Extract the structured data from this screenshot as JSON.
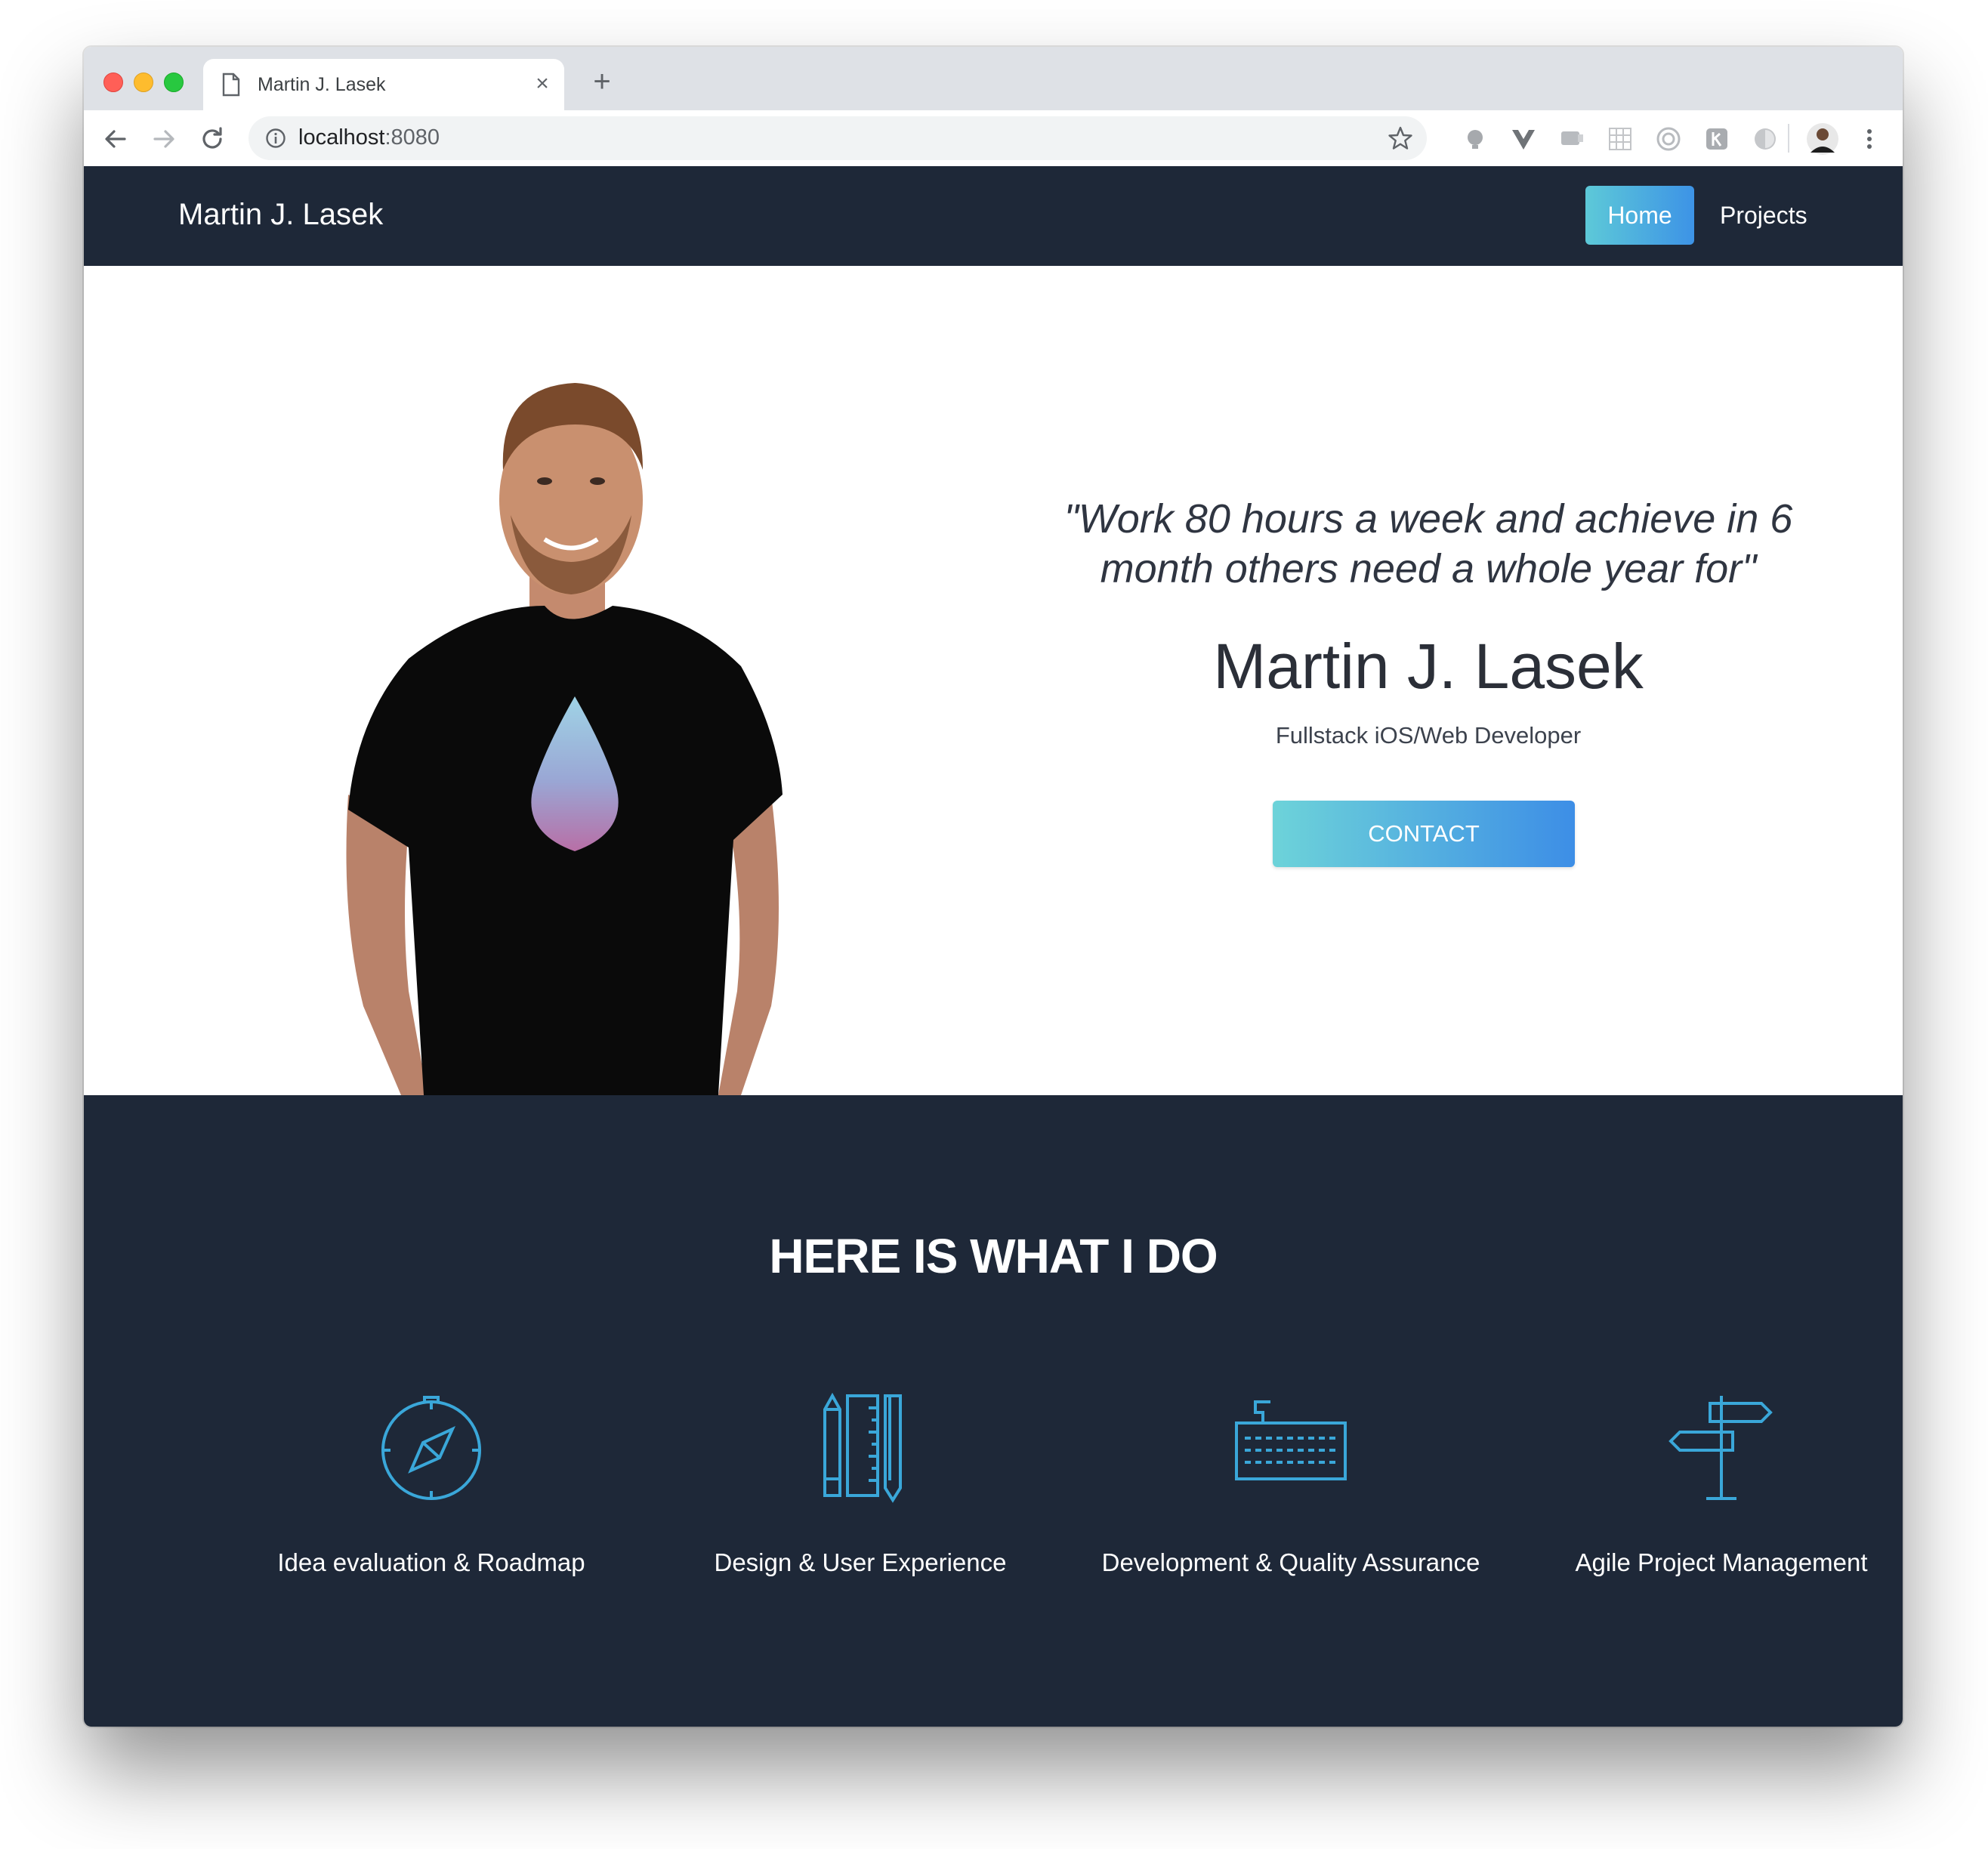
{
  "browser": {
    "tab_title": "Martin J. Lasek",
    "url_host": "localhost",
    "url_port": ":8080"
  },
  "nav": {
    "brand": "Martin J. Lasek",
    "items": [
      {
        "label": "Home",
        "active": true
      },
      {
        "label": "Projects",
        "active": false
      }
    ]
  },
  "hero": {
    "quote": "\"Work 80 hours a week and achieve in 6 month others need a whole year for\"",
    "name": "Martin J. Lasek",
    "role": "Fullstack iOS/Web Developer",
    "cta": "CONTACT"
  },
  "services": {
    "title": "HERE IS WHAT I DO",
    "items": [
      {
        "icon": "compass-icon",
        "label": "Idea evaluation & Roadmap"
      },
      {
        "icon": "pencil-ruler-icon",
        "label": "Design & User Experience"
      },
      {
        "icon": "keyboard-icon",
        "label": "Development & Quality Assurance"
      },
      {
        "icon": "signpost-icon",
        "label": "Agile Project Management"
      }
    ]
  },
  "colors": {
    "nav_bg": "#1e2838",
    "accent_start": "#5dc9d8",
    "accent_end": "#3d93e6",
    "icon_stroke": "#3aa7d9"
  }
}
